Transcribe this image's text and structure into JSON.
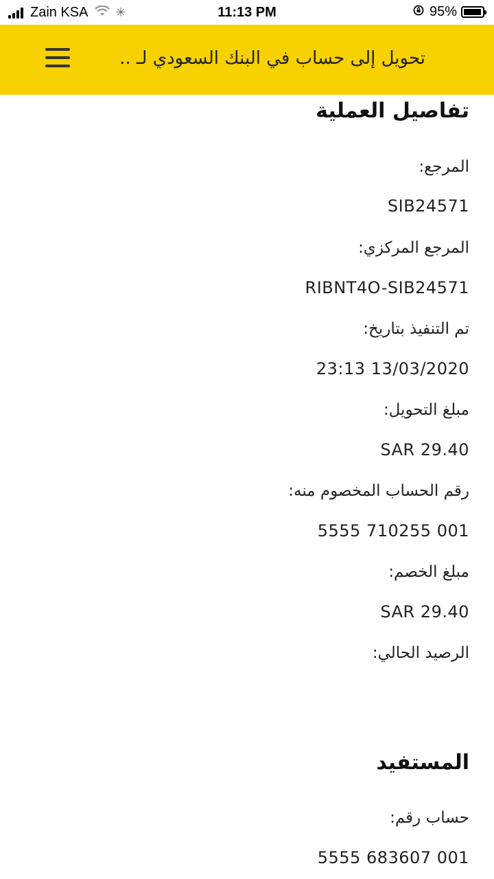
{
  "status_bar": {
    "carrier": "Zain KSA",
    "time": "11:13 PM",
    "battery_percent": "95%",
    "battery_level": 0.95
  },
  "header": {
    "title": "تحويل إلى حساب في البنك السعودي لـ ..",
    "menu_icon": "hamburger-menu-icon"
  },
  "details": {
    "section_title": "تفاصيل العملية",
    "reference_label": "المرجع:",
    "reference_value": "SIB24571",
    "central_reference_label": "المرجع المركزي:",
    "central_reference_value": "RIBNT4O-SIB24571",
    "executed_on_label": "تم التنفيذ بتاريخ:",
    "executed_on_value": "23:13 13/03/2020",
    "transfer_amount_label": "مبلغ التحويل:",
    "transfer_amount_value": "SAR 29.40",
    "debited_account_label": "رقم الحساب المخصوم منه:",
    "debited_account_value": "5555 710255 001",
    "debit_amount_label": "مبلغ الخصم:",
    "debit_amount_value": "SAR 29.40",
    "current_balance_label": "الرصيد الحالي:"
  },
  "beneficiary": {
    "section_title": "المستفيد",
    "account_label": "حساب رقم:",
    "account_value": "5555 683607 001"
  }
}
